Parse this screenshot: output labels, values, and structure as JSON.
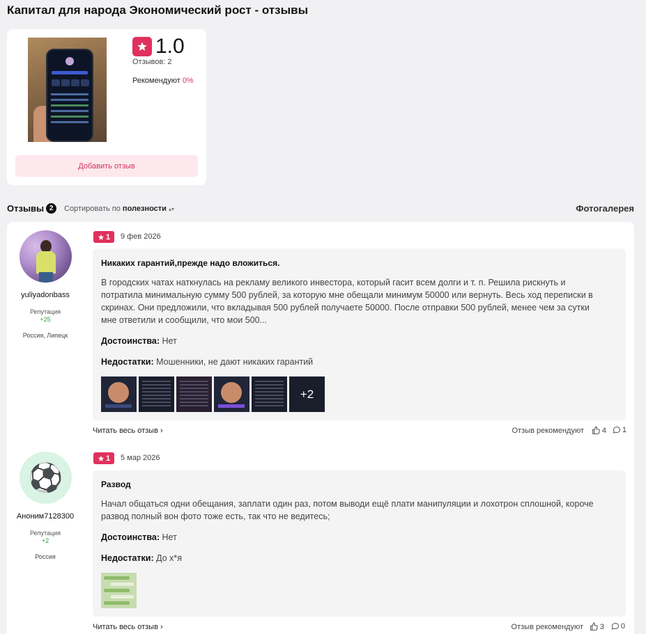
{
  "page": {
    "title": "Капитал для народа Экономический рост - отзывы"
  },
  "product": {
    "rating": "1.0",
    "reviews_count": "Отзывов: 2",
    "recommend_label": "Рекомендуют",
    "recommend_pct": "0%",
    "add_review_label": "Добавить отзыв",
    "photo_icon": "phone-photo"
  },
  "reviews_section": {
    "title": "Отзывы",
    "count": "2",
    "sort_prefix": "Сортировать по",
    "sort_value": "полезности",
    "gallery_label": "Фотогалерея"
  },
  "reviews": [
    {
      "username": "yuliyadonbass",
      "rep_label": "Репутация",
      "rep_value": "+25",
      "location": "Россия, Липецк",
      "stars": "1",
      "date": "9 фев 2026",
      "title": "Никаких гарантий,прежде надо вложиться.",
      "text": "В городских чатах наткнулась на рекламу великого инвестора, который гасит всем долги и т. п. Решила рискнуть и потратила минимальную сумму 500 рублей, за которую мне обещали минимум 50000 или вернуть. Весь ход переписки в скринах. Они предложили, что вкладывая 500 рублей получаете 50000. После отправки 500 рублей, менее чем за сутки мне ответили и сообщили, что мои 500...",
      "pros_label": "Достоинства:",
      "pros": "Нет",
      "cons_label": "Недостатки:",
      "cons": "Мошенники, не дают никаких гарантий",
      "more_photos": "+2",
      "read_more": "Читать весь отзыв",
      "recommends_label": "Отзыв рекомендуют",
      "likes": "4",
      "comments": "1"
    },
    {
      "username": "Аноним7128300",
      "rep_label": "Репутация",
      "rep_value": "+2",
      "location": "Россия",
      "stars": "1",
      "date": "5 мар 2026",
      "title": "Развод",
      "text": "Начал общаться одни обещания, заплати один раз, потом выводи ещё плати манипуляции и лохотрон сплошной, короче развод полный вон фото тоже есть, так что не ведитесь;",
      "pros_label": "Достоинства:",
      "pros": "Нет",
      "cons_label": "Недостатки:",
      "cons": "До х*я",
      "read_more": "Читать весь отзыв",
      "recommends_label": "Отзыв рекомендуют",
      "likes": "3",
      "comments": "0"
    }
  ],
  "colors": {
    "accent": "#e0315e",
    "accent_light": "#fde8ee",
    "reputation": "#2a9a3a",
    "background": "#f1f1f3"
  }
}
